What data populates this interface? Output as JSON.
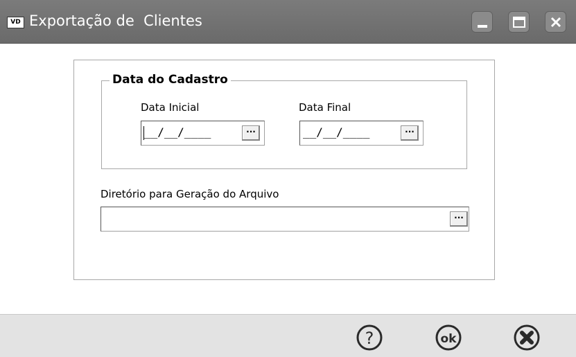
{
  "window": {
    "app_icon_text": "VD",
    "title": "Exportação de  Clientes"
  },
  "group": {
    "title": "Data do Cadastro",
    "start_label": "Data Inicial",
    "end_label": "Data Final",
    "start_value": "__/__/____",
    "end_value": "__/__/____",
    "picker_label": "···"
  },
  "directory": {
    "label": "Diretório para Geração do Arquivo",
    "value": "",
    "picker_label": "···"
  },
  "footer": {
    "help_label": "?",
    "ok_label": "ok",
    "close_icon": "close-circle-icon"
  },
  "colors": {
    "titlebar": "#6f6f6f",
    "footer": "#e3e3e3",
    "border": "#a8a8a8"
  }
}
